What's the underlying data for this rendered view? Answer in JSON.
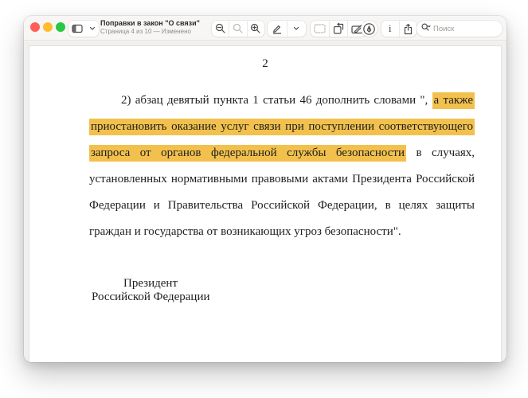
{
  "window": {
    "title": "Поправки в закон \"О связи\"",
    "subtitle": "Страница 4 из 10 — Изменено",
    "traffic_lights": [
      "#FF5F57",
      "#FEBC2E",
      "#28C840"
    ]
  },
  "toolbar": {
    "search_placeholder": "Поиск",
    "icons": {
      "sidebar": "sidebar-toggle-icon",
      "sidebar_chevron": "chevron-down-icon",
      "zoom_out": "magnifier-minus-icon",
      "zoom_actual": "magnifier-icon",
      "zoom_in": "magnifier-plus-icon",
      "pen": "marker-pen-icon",
      "pen_chevron": "chevron-down-icon",
      "select": "dashed-selection-icon",
      "rotate": "rotate-icon",
      "markup": "markup-toolbar-icon",
      "highlight": "highlighter-nib-icon",
      "info": "info-icon",
      "share": "share-icon",
      "search": "search-icon"
    }
  },
  "document": {
    "page_number": "2",
    "highlight_color": "#F2C14D",
    "paragraph_lines": [
      {
        "pre": "2) абзац девятый пункта 1 статьи 46 дополнить словами \", ",
        "hl": "а также",
        "post": ""
      },
      {
        "pre": "",
        "hl": "приостановить оказание услуг связи при поступлении соответствующего",
        "post": ""
      },
      {
        "pre": "",
        "hl": "запроса от органов федеральной службы безопасности",
        "post": " в случаях,"
      },
      {
        "pre": "установленных нормативными правовыми актами Президента Российской",
        "hl": "",
        "post": ""
      },
      {
        "pre": "Федерации и Правительства Российской Федерации, в целях защиты",
        "hl": "",
        "post": ""
      },
      {
        "pre": "граждан и государства от возникающих угроз безопасности\".",
        "hl": "",
        "post": ""
      }
    ],
    "signature": {
      "line1": "Президент",
      "line2": "Российской Федерации"
    }
  }
}
